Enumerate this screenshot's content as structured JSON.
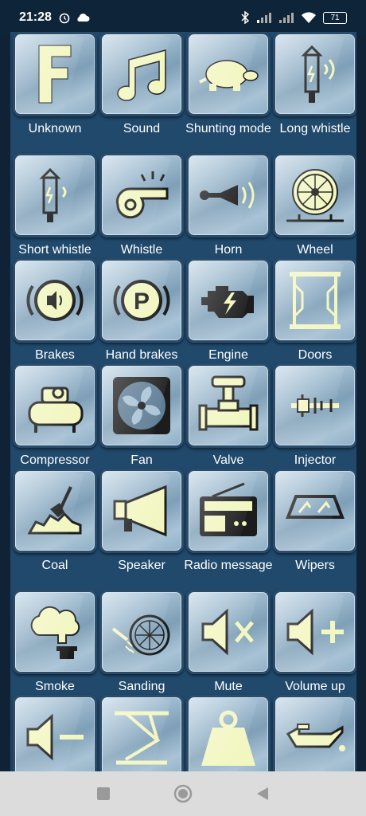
{
  "status_bar": {
    "time": "21:28",
    "battery": "71",
    "icons": [
      "alarm-icon",
      "cloud-icon",
      "bluetooth-icon",
      "signal-icon",
      "signal-icon",
      "wifi-icon",
      "battery-icon"
    ]
  },
  "functions": [
    {
      "label": "Unknown",
      "icon": "letter-f-icon"
    },
    {
      "label": "Sound",
      "icon": "music-note-icon"
    },
    {
      "label": "Shunting mode",
      "icon": "turtle-icon"
    },
    {
      "label": "Long whistle",
      "icon": "long-whistle-icon"
    },
    {
      "label": "Short whistle",
      "icon": "short-whistle-icon"
    },
    {
      "label": "Whistle",
      "icon": "whistle-icon"
    },
    {
      "label": "Horn",
      "icon": "horn-icon"
    },
    {
      "label": "Wheel",
      "icon": "wheel-icon"
    },
    {
      "label": "Brakes",
      "icon": "brakes-icon"
    },
    {
      "label": "Hand brakes",
      "icon": "hand-brakes-icon"
    },
    {
      "label": "Engine",
      "icon": "engine-icon"
    },
    {
      "label": "Doors",
      "icon": "doors-icon"
    },
    {
      "label": "Compressor",
      "icon": "compressor-icon"
    },
    {
      "label": "Fan",
      "icon": "fan-icon"
    },
    {
      "label": "Valve",
      "icon": "valve-icon"
    },
    {
      "label": "Injector",
      "icon": "injector-icon"
    },
    {
      "label": "Coal",
      "icon": "coal-icon"
    },
    {
      "label": "Speaker",
      "icon": "megaphone-icon"
    },
    {
      "label": "Radio message",
      "icon": "radio-icon"
    },
    {
      "label": "Wipers",
      "icon": "wipers-icon"
    },
    {
      "label": "Smoke",
      "icon": "smoke-icon"
    },
    {
      "label": "Sanding",
      "icon": "sanding-icon"
    },
    {
      "label": "Mute",
      "icon": "mute-icon"
    },
    {
      "label": "Volume up",
      "icon": "volume-up-icon"
    },
    {
      "label": "",
      "icon": "volume-down-icon"
    },
    {
      "label": "",
      "icon": "pantograph-icon"
    },
    {
      "label": "",
      "icon": "weight-icon"
    },
    {
      "label": "",
      "icon": "oil-can-icon"
    }
  ],
  "nav": {
    "buttons": [
      "recents-button",
      "home-button",
      "back-button"
    ]
  },
  "colors": {
    "icon_fill": "#f2f6bf",
    "icon_stroke": "#1c1c1c",
    "panel_bg": "#20496c",
    "tile_light": "#c9dbe7"
  }
}
